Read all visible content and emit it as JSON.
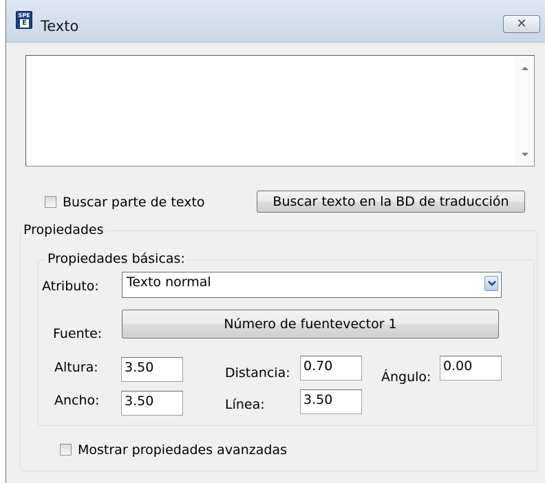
{
  "window": {
    "title": "Texto",
    "app_icon_top": "SPE",
    "app_icon_bottom": "E",
    "close_glyph": "✕"
  },
  "text_area": {
    "value": ""
  },
  "search_part": {
    "label": "Buscar parte de texto",
    "checked": false
  },
  "search_db_button": {
    "label": "Buscar texto en la BD de traducción"
  },
  "properties": {
    "legend": "Propiedades",
    "basic": {
      "legend": "Propiedades básicas:",
      "attribute_label": "Atributo:",
      "attribute_value": "Texto normal",
      "font_label": "Fuente:",
      "font_button": "Número de fuentevector 1",
      "height_label": "Altura:",
      "height_value": "3.50",
      "distance_label": "Distancia:",
      "distance_value": "0.70",
      "angle_label": "Ángulo:",
      "angle_value": "0.00",
      "width_label": "Ancho:",
      "width_value": "3.50",
      "line_label": "Línea:",
      "line_value": "3.50"
    },
    "advanced_checkbox": {
      "label": "Mostrar propiedades avanzadas",
      "checked": false
    }
  }
}
